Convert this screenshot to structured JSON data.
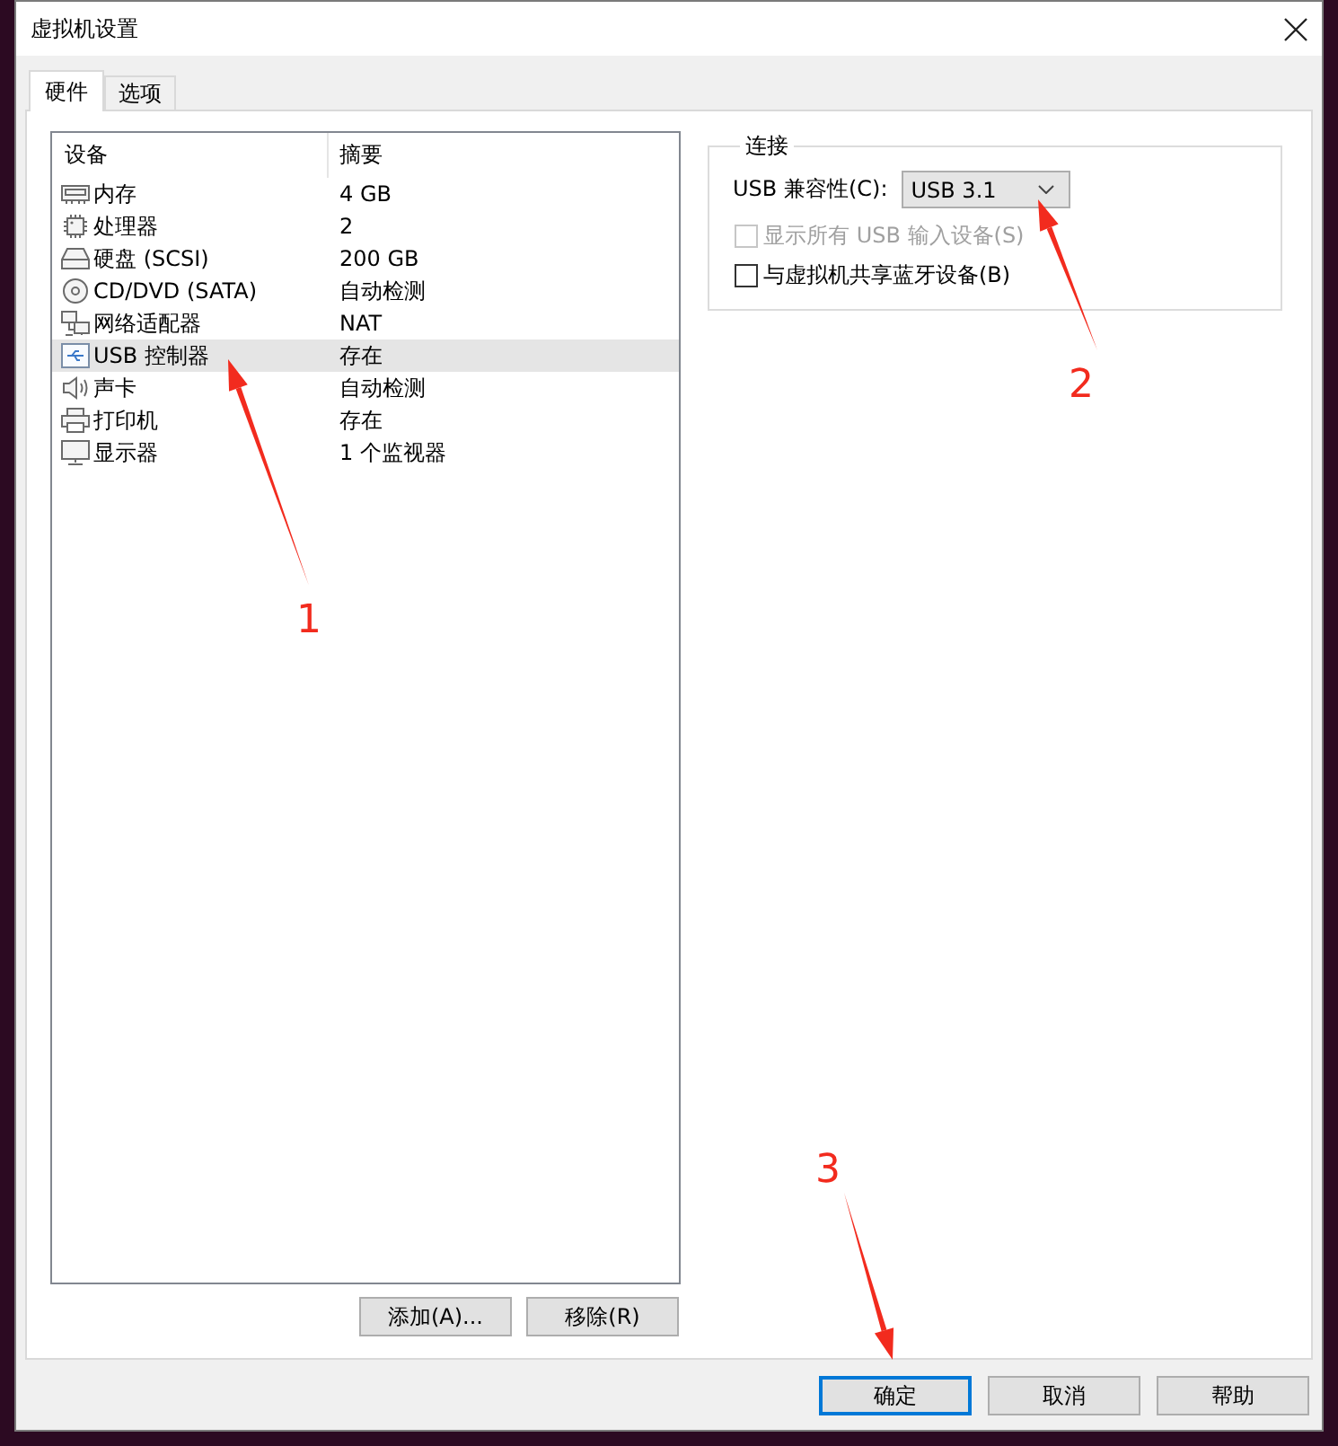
{
  "window": {
    "title": "虚拟机设置"
  },
  "tabs": [
    {
      "label": "硬件",
      "selected": true
    },
    {
      "label": "选项",
      "selected": false
    }
  ],
  "device_list": {
    "columns": [
      "设备",
      "摘要"
    ],
    "rows": [
      {
        "kind": "memory",
        "device": "内存",
        "summary": "4 GB",
        "selected": false
      },
      {
        "kind": "cpu",
        "device": "处理器",
        "summary": "2",
        "selected": false
      },
      {
        "kind": "disk",
        "device": "硬盘 (SCSI)",
        "summary": "200 GB",
        "selected": false
      },
      {
        "kind": "cdrom",
        "device": "CD/DVD (SATA)",
        "summary": "自动检测",
        "selected": false
      },
      {
        "kind": "network",
        "device": "网络适配器",
        "summary": "NAT",
        "selected": false
      },
      {
        "kind": "usb",
        "device": "USB 控制器",
        "summary": "存在",
        "selected": true
      },
      {
        "kind": "sound",
        "device": "声卡",
        "summary": "自动检测",
        "selected": false
      },
      {
        "kind": "printer",
        "device": "打印机",
        "summary": "存在",
        "selected": false
      },
      {
        "kind": "display",
        "device": "显示器",
        "summary": "1 个监视器",
        "selected": false
      }
    ]
  },
  "device_buttons": [
    "添加(A)...",
    "移除(R)"
  ],
  "connection": {
    "legend": "连接",
    "compat_label": "USB 兼容性(C):",
    "compat_value": "USB 3.1",
    "options": [
      {
        "label": "显示所有 USB 输入设备(S)",
        "checked": false,
        "disabled": true
      },
      {
        "label": "与虚拟机共享蓝牙设备(B)",
        "checked": false,
        "disabled": false
      }
    ]
  },
  "buttons": [
    {
      "label": "确定",
      "default": true
    },
    {
      "label": "取消",
      "default": false
    },
    {
      "label": "帮助",
      "default": false
    }
  ],
  "annotations": [
    {
      "label": "1"
    },
    {
      "label": "2"
    },
    {
      "label": "3"
    }
  ]
}
